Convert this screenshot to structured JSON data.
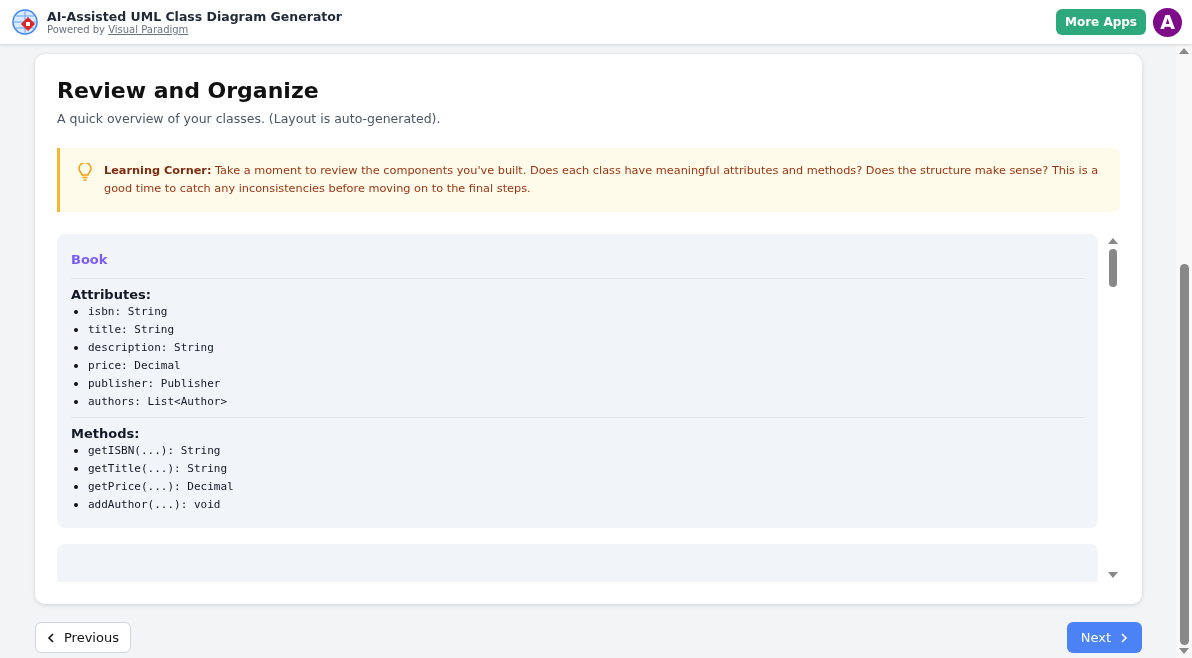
{
  "header": {
    "title": "AI-Assisted UML Class Diagram Generator",
    "powered_by": "Powered by",
    "powered_link": "Visual Paradigm",
    "more_apps": "More Apps",
    "avatar": "A"
  },
  "section": {
    "title": "Review and Organize",
    "subtitle": "A quick overview of your classes. (Layout is auto-generated).",
    "tip": "**Learning Corner:** Take a moment to review the components you've built. Does each class have meaningful attributes and methods? Does the structure make sense? This is a good time to catch any inconsistencies before moving on to the final steps."
  },
  "classes": [
    {
      "name": "Book",
      "attributes_label": "Attributes:",
      "attributes": [
        "isbn: String",
        "title: String",
        "description: String",
        "price: Decimal",
        "publisher: Publisher",
        "authors: List<Author>"
      ],
      "methods_label": "Methods:",
      "methods": [
        "getISBN(...): String",
        "getTitle(...): String",
        "getPrice(...): Decimal",
        "addAuthor(...): void"
      ]
    }
  ],
  "nav": {
    "previous": "Previous",
    "next": "Next"
  }
}
